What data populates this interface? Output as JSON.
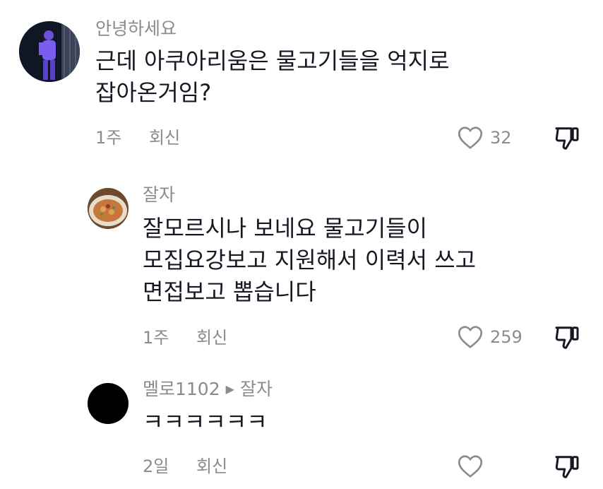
{
  "comments": [
    {
      "username": "안녕하세요",
      "text": "근데 아쿠아리움은 물고기들을 억지로\n잡아온거임?",
      "time": "1주",
      "reply_label": "회신",
      "likes": "32"
    },
    {
      "username": "잘자",
      "text": "잘모르시나 보네요 물고기들이\n모집요강보고 지원해서 이력서 쓰고\n면접보고 뽑습니다",
      "time": "1주",
      "reply_label": "회신",
      "likes": "259"
    },
    {
      "username": "멜로1102",
      "reply_to": "잘자",
      "text": "ㅋㅋㅋㅋㅋㅋ",
      "time": "2일",
      "reply_label": "회신",
      "likes": ""
    }
  ],
  "colors": {
    "text_primary": "#161823",
    "text_secondary": "#8a8b91"
  },
  "icons": [
    "heart-outline-icon",
    "thumbs-down-icon",
    "reply-arrow-icon"
  ]
}
